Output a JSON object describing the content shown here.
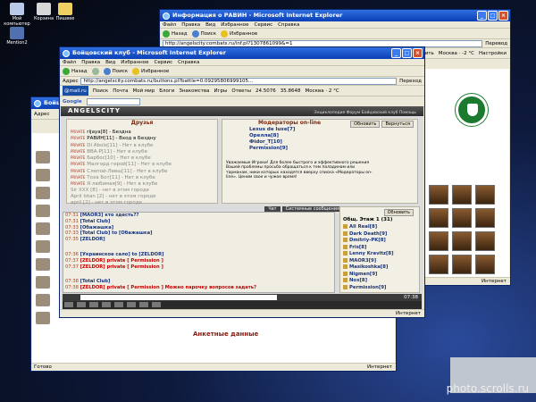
{
  "desktop": {
    "icons": [
      {
        "label": "Мой компьютер",
        "color": "#b9c9e8"
      },
      {
        "label": "Корзина",
        "color": "#d8d8d8"
      },
      {
        "label": "Пишвее",
        "color": "#f0d060"
      },
      {
        "label": "Mention2",
        "color": "#5070b0"
      }
    ],
    "watermark": "photo.scrolls.ru"
  },
  "win_back_right": {
    "title": "Информация о РАВИН - Microsoft Internet Explorer",
    "menu": [
      "Файл",
      "Правка",
      "Вид",
      "Избранное",
      "Сервис",
      "Справка"
    ],
    "toolbar": [
      "Назад",
      "Поиск",
      "Избранное"
    ],
    "address": "http://angelscity.combats.ru/inf.pl?1307861099&=1",
    "translate": "Перевод",
    "send": "Отправить",
    "weather": "Москва · -2 °C",
    "settings": "Настройки",
    "status": "Интернет"
  },
  "win_back_left": {
    "title": "Бойцовский клуб",
    "address_label": "Адрес",
    "tab": "Чат",
    "anketa": "Анкетные данные",
    "status": "Готово",
    "status_right": "Интернет"
  },
  "win_front": {
    "title": "Бойцовский клуб - Microsoft Internet Explorer",
    "menu": [
      "Файл",
      "Правка",
      "Вид",
      "Избранное",
      "Сервис",
      "Справка"
    ],
    "toolbar": [
      "Назад",
      "Поиск",
      "Избранное"
    ],
    "address_label": "Адрес",
    "address": "http://angelscity.combats.ru/buttons.pl?battle=0.09295806999105...",
    "go": "Переход",
    "mail_label": "@mail.ru",
    "toolbar2": [
      "Поиск",
      "Почта",
      "Мой мир",
      "Блоги",
      "Знакомства",
      "Игры",
      "Ответы"
    ],
    "currency": "24.5076",
    "currency2": "35.8648",
    "weather": "Москва · 2 °C",
    "google": "Google",
    "game_logo": "ANGELSCITY",
    "game_links": "Энциклопедия  Форум  Бойцовский клуб  Помощь",
    "friends_title": "Друзья",
    "friends": [
      {
        "name": "rijaya[8] - Бездна",
        "on": true
      },
      {
        "name": "РАВИН[11] - Вход в Бездну",
        "on": true
      },
      {
        "name": "Di Abolo[11] - Нет в клубе",
        "on": false
      },
      {
        "name": "ВВА-Р[11] - Нет в клубе",
        "on": false
      },
      {
        "name": "Барбос[10] - Нет в клубе",
        "on": false
      },
      {
        "name": "Малгорд герой[11] - Нет в клубе",
        "on": false
      },
      {
        "name": "Слепой-Левш[11] - Нет в клубе",
        "on": false
      },
      {
        "name": "Тоха Бот[11] - Нет в клубе",
        "on": false
      },
      {
        "name": "Я любимая[9] - Нет в клубе",
        "on": false
      },
      {
        "name": "Sir XXX [8] - нет в этом городе",
        "on": false
      },
      {
        "name": "April Istan [2] - нет в этом городе",
        "on": false
      },
      {
        "name": "april [2] - нет в этом городе",
        "on": false
      }
    ],
    "mods_title": "Модераторы on-line",
    "mods": [
      "Lexus de luxe[7]",
      "Орелла[8]",
      "Фidor_T[10]",
      "Permission[9]"
    ],
    "mods_note": "Уважаемые Игроки! Для более быстрого и эффективного решения Вашей проблемы просьба обращаться к тем паладинам или тарманам, ники которых находятся вверху списка «Модераторы on-line». Ценим свое и чужое время!",
    "update_btn": "Обновить",
    "back_btn": "Вернуться",
    "chat_tabs": [
      "Чат",
      "Системные сообщения"
    ],
    "chat": [
      {
        "time": "07:31",
        "text": "[MAOR3] кто здесть??",
        "type": "msg"
      },
      {
        "time": "07:31",
        "text": "[Total Club] ",
        "type": "msg"
      },
      {
        "time": "07:33",
        "text": "[Обажашка] ",
        "type": "msg"
      },
      {
        "time": "07:33",
        "text": "[Total Club] to [Обажашка]",
        "type": "msg"
      },
      {
        "time": "07:35",
        "text": "[ZELDOR]",
        "type": "msg"
      },
      {
        "time": "",
        "text": "",
        "type": "gap"
      },
      {
        "time": "07:36",
        "text": "[Украинское сало] to [ZELDOR]",
        "type": "msg"
      },
      {
        "time": "07:37",
        "text": "[ZELDOR] private [ Permission ]",
        "type": "pv"
      },
      {
        "time": "07:37",
        "text": "[ZELDOR] private [ Permission ]",
        "type": "pv"
      },
      {
        "time": "",
        "text": "",
        "type": "gap"
      },
      {
        "time": "07:38",
        "text": "[Total Club]",
        "type": "msg"
      },
      {
        "time": "07:38",
        "text": "[ZELDOR] private [ Permission ] Можно парочку вопросов задать?",
        "type": "pv"
      }
    ],
    "online_refresh": "Обновить",
    "online_head": "Общ. Этаж 1 (31)",
    "online": [
      "All Real[8]",
      "Dark Death[9]",
      "Dmitriy-PK[8]",
      "Fris[8]",
      "Lenny Kravitz[8]",
      "MAOR3[9]",
      "Masikoshka[8]",
      "Nigmen[9]",
      "Nox[8]",
      "Permission[9]"
    ],
    "clock": "07:38",
    "status": "Интернет"
  }
}
